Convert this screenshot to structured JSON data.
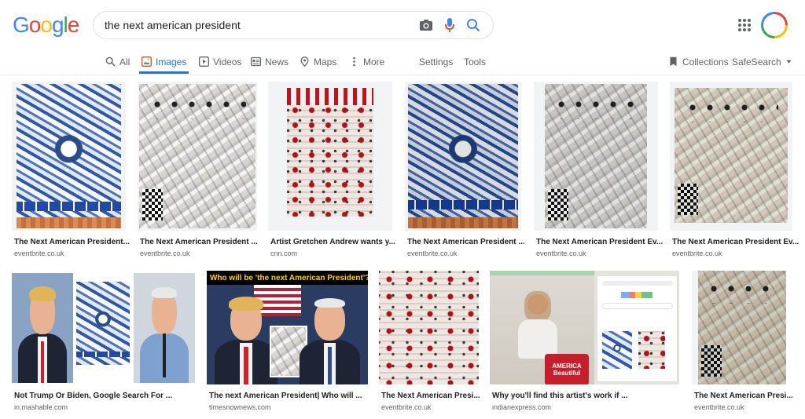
{
  "header": {
    "logo_letters": [
      {
        "ch": "G",
        "color": "#4285f4"
      },
      {
        "ch": "o",
        "color": "#ea4335"
      },
      {
        "ch": "o",
        "color": "#fbbc05"
      },
      {
        "ch": "g",
        "color": "#4285f4"
      },
      {
        "ch": "l",
        "color": "#34a853"
      },
      {
        "ch": "e",
        "color": "#ea4335"
      }
    ],
    "search": {
      "value": "the next american president"
    },
    "icons": [
      "camera-icon",
      "microphone-icon",
      "search-icon",
      "apps-icon"
    ]
  },
  "tabs": {
    "all": "All",
    "images": "Images",
    "videos": "Videos",
    "news": "News",
    "maps": "Maps",
    "more": "More",
    "settings": "Settings",
    "tools": "Tools",
    "collections": "Collections",
    "safesearch": "SafeSearch"
  },
  "colors": {
    "accent": "#1a73e8",
    "text_secondary": "#5f6368",
    "thumb_bg": "#f1f3f4"
  },
  "results": [
    {
      "title": "The Next American President...",
      "site": "eventbrite.co.uk"
    },
    {
      "title": "The Next American President ...",
      "site": "eventbrite.co.uk"
    },
    {
      "title": "Artist Gretchen Andrew wants y...",
      "site": "cnn.com"
    },
    {
      "title": "The Next American President ...",
      "site": "eventbrite.co.uk"
    },
    {
      "title": "The Next American President Ev...",
      "site": "eventbrite.co.uk"
    },
    {
      "title": "The Next American President Ev...",
      "site": "eventbrite.co.uk"
    },
    {
      "title": "Not Trump Or Biden, Google Search For ...",
      "site": "in.mashable.com"
    },
    {
      "title": "The next American President| Who will ...",
      "site": "timesnownews.com",
      "overlay": "Who will be 'the next American President'?"
    },
    {
      "title": "The Next American Presi...",
      "site": "eventbrite.co.uk"
    },
    {
      "title": "Why you'll find this artist's work if ...",
      "site": "indianexpress.com",
      "overlay": "AMERICA Beautiful"
    },
    {
      "title": "The Next American Presi...",
      "site": "eventbrite.co.uk"
    }
  ]
}
